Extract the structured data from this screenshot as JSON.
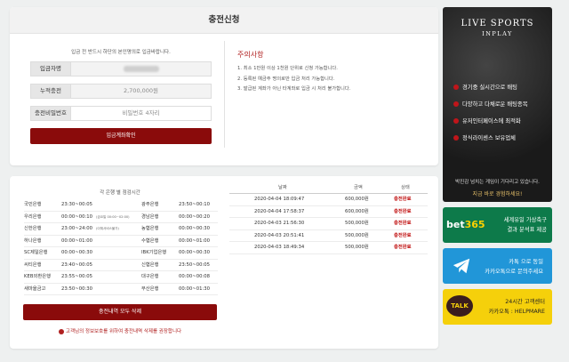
{
  "charge": {
    "title": "충전신청",
    "notice": "입금 전 반드시 하단의 본인명의로 입금바랍니다.",
    "fields": [
      {
        "label": "입금자명",
        "value": ""
      },
      {
        "label": "누적충전",
        "value": "2,700,000원"
      },
      {
        "label": "충전비밀번호",
        "placeholder": "비밀번호 4자리"
      }
    ],
    "confirm_button": "입금계좌확인"
  },
  "caution": {
    "title": "주의사항",
    "items": [
      "1. 최소 1만원 이상 1천원 단위로 신청 가능합니다.",
      "2. 등록된 예금주 명의로만 입금 처리 가능합니다.",
      "3. 발급된 계좌가 아닌 타계좌로 입금 시 처리 불가합니다."
    ]
  },
  "banks": {
    "title": "각 은행 별 점검시간",
    "rows": [
      {
        "bank1": "국민은행",
        "time1": "23:30~00:05",
        "note1": "",
        "bank2": "광주은행",
        "time2": "23:50~00:10"
      },
      {
        "bank1": "우리은행",
        "time1": "00:00~00:10",
        "note1": "(금요일 00:00~02:00)",
        "bank2": "경남은행",
        "time2": "00:00~00:20"
      },
      {
        "bank1": "신한은행",
        "time1": "23:00~24:00",
        "note1": "(이체서비스불가)",
        "bank2": "농협은행",
        "time2": "00:00~00:30"
      },
      {
        "bank1": "하나은행",
        "time1": "00:00~01:00",
        "note1": "",
        "bank2": "수협은행",
        "time2": "00:00~01:00"
      },
      {
        "bank1": "SC제일은행",
        "time1": "00:00~00:30",
        "note1": "",
        "bank2": "IBK기업은행",
        "time2": "00:00~00:30"
      },
      {
        "bank1": "씨티은행",
        "time1": "23:40~00:05",
        "note1": "",
        "bank2": "신협은행",
        "time2": "23:50~00:05"
      },
      {
        "bank1": "KEB외환은행",
        "time1": "23:55~00:05",
        "note1": "",
        "bank2": "대구은행",
        "time2": "00:00~00:08"
      },
      {
        "bank1": "새마을금고",
        "time1": "23:50~00:30",
        "note1": "",
        "bank2": "부산은행",
        "time2": "00:00~01:30"
      }
    ],
    "delete_button": "충전내역 모두 삭제",
    "warning": "고객님의 정보보호를 위하여 충전내역 삭제를 권장합니다"
  },
  "history": {
    "headers": [
      "날짜",
      "금액",
      "상태"
    ],
    "rows": [
      {
        "date": "2020-04-04 18:09:47",
        "amount": "600,000원",
        "status": "충전완료"
      },
      {
        "date": "2020-04-04 17:58:37",
        "amount": "600,000원",
        "status": "충전완료"
      },
      {
        "date": "2020-04-03 21:56:30",
        "amount": "500,000원",
        "status": "충전완료"
      },
      {
        "date": "2020-04-03 20:51:41",
        "amount": "500,000원",
        "status": "충전완료"
      },
      {
        "date": "2020-04-03 18:49:34",
        "amount": "500,000원",
        "status": "충전완료"
      }
    ]
  },
  "ads": {
    "live": {
      "brand": "LIVE SPORTS",
      "sub": "INPLAY",
      "items": [
        "경기중 실시간으로 배팅",
        "다양하고 다채로운 배팅종목",
        "유저인터페이스에 최적화",
        "정식라이센스 보유업체"
      ],
      "tagline": "박진감 넘치는 게임이 기다리고 있습니다.",
      "cta": "지금 바로 경험하세요!"
    },
    "bet365": {
      "logo_a": "bet",
      "logo_b": "365",
      "line1": "세계유일 가상축구",
      "line2": "결과 분석표 제공"
    },
    "telegram": {
      "line1": "카톡 으로 동일",
      "line2": "카카오톡으로 문의주세요"
    },
    "kakao": {
      "logo": "TALK",
      "line1": "24시간 고객센터",
      "line2": "카카오톡 : HELPMARE"
    }
  },
  "colors": {
    "accent": "#8a0b0b",
    "status": "#c01010"
  }
}
